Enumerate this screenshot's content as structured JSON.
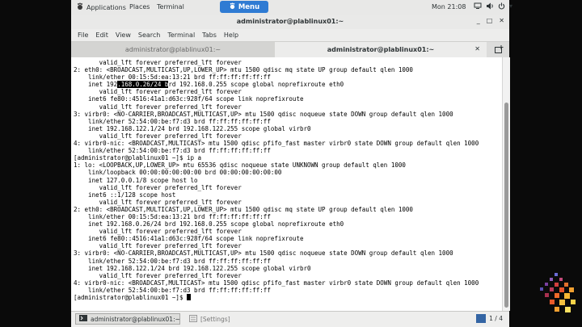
{
  "topbar": {
    "applications": "Applications",
    "places": "Places",
    "terminal": "Terminal",
    "menu": "Menu",
    "clock": "Mon 21:08"
  },
  "window": {
    "title": "administrator@plablinux01:~"
  },
  "menubar": [
    "File",
    "Edit",
    "View",
    "Search",
    "Terminal",
    "Tabs",
    "Help"
  ],
  "tabs": [
    {
      "label": "administrator@plablinux01:~"
    },
    {
      "label": "administrator@plablinux01:~"
    }
  ],
  "terminal": {
    "before_highlight": "       valid_lft forever preferred_lft forever\n2: eth0: <BROADCAST,MULTICAST,UP,LOWER_UP> mtu 1500 qdisc mq state UP group default qlen 1000\n    link/ether 00:15:5d:ea:13:21 brd ff:ff:ff:ff:ff:ff\n    inet 192",
    "highlight": ".168.0.26/24 b",
    "after_highlight": "rd 192.168.0.255 scope global noprefixroute eth0\n       valid_lft forever preferred_lft forever\n    inet6 fe80::4516:41a1:d63c:928f/64 scope link noprefixroute\n       valid_lft forever preferred_lft forever\n3: virbr0: <NO-CARRIER,BROADCAST,MULTICAST,UP> mtu 1500 qdisc noqueue state DOWN group default qlen 1000\n    link/ether 52:54:00:be:f7:d3 brd ff:ff:ff:ff:ff:ff\n    inet 192.168.122.1/24 brd 192.168.122.255 scope global virbr0\n       valid_lft forever preferred_lft forever\n4: virbr0-nic: <BROADCAST,MULTICAST> mtu 1500 qdisc pfifo_fast master virbr0 state DOWN group default qlen 1000\n    link/ether 52:54:00:be:f7:d3 brd ff:ff:ff:ff:ff:ff\n[administrator@plablinux01 ~]$ ip a\n1: lo: <LOOPBACK,UP,LOWER_UP> mtu 65536 qdisc noqueue state UNKNOWN group default qlen 1000\n    link/loopback 00:00:00:00:00:00 brd 00:00:00:00:00:00\n    inet 127.0.0.1/8 scope host lo\n       valid_lft forever preferred_lft forever\n    inet6 ::1/128 scope host\n       valid_lft forever preferred_lft forever\n2: eth0: <BROADCAST,MULTICAST,UP,LOWER_UP> mtu 1500 qdisc mq state UP group default qlen 1000\n    link/ether 00:15:5d:ea:13:21 brd ff:ff:ff:ff:ff:ff\n    inet 192.168.0.26/24 brd 192.168.0.255 scope global noprefixroute eth0\n       valid_lft forever preferred_lft forever\n    inet6 fe80::4516:41a1:d63c:928f/64 scope link noprefixroute\n       valid_lft forever preferred_lft forever\n3: virbr0: <NO-CARRIER,BROADCAST,MULTICAST,UP> mtu 1500 qdisc noqueue state DOWN group default qlen 1000\n    link/ether 52:54:00:be:f7:d3 brd ff:ff:ff:ff:ff:ff\n    inet 192.168.122.1/24 brd 192.168.122.255 scope global virbr0\n       valid_lft forever preferred_lft forever\n4: virbr0-nic: <BROADCAST,MULTICAST> mtu 1500 qdisc pfifo_fast master virbr0 state DOWN group default qlen 1000\n    link/ether 52:54:00:be:f7:d3 brd ff:ff:ff:ff:ff:ff\n",
    "prompt": "[administrator@plablinux01 ~]$ "
  },
  "taskbar": {
    "items": [
      {
        "label": "administrator@plablinux01:~"
      },
      {
        "label": "[Settings]"
      }
    ],
    "pager": "1 / 4"
  },
  "icons": {
    "applications": "foot-icon",
    "menu": "gnome-foot-icon",
    "network": "network-icon",
    "volume": "volume-icon",
    "power": "power-icon",
    "new_tab": "new-tab-icon",
    "terminal": "terminal-icon",
    "settings": "settings-icon"
  },
  "colors": {
    "accent": "#2f7bd3",
    "terminal_bg": "#ffffff",
    "terminal_fg": "#000000"
  }
}
